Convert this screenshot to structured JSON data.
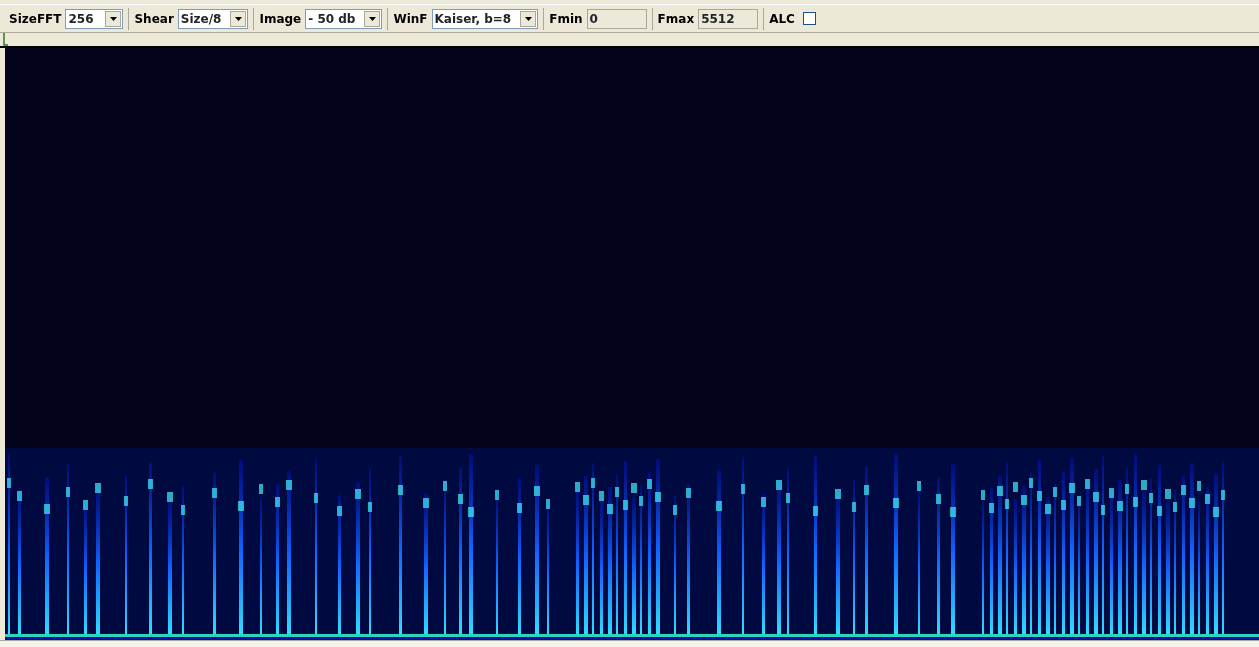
{
  "toolbar": [
    {
      "kind": "dropdown",
      "label": "SizeFFT",
      "value": "256"
    },
    {
      "kind": "dropdown",
      "label": "Shear",
      "value": "Size/8"
    },
    {
      "kind": "dropdown",
      "label": "Image",
      "value": "- 50 db"
    },
    {
      "kind": "dropdown",
      "label": "WinF",
      "value": "Kaiser, b=8"
    },
    {
      "kind": "readonly",
      "label": "Fmin",
      "value": "0"
    },
    {
      "kind": "readonly",
      "label": "Fmax",
      "value": "5512"
    },
    {
      "kind": "checkbox",
      "label": "ALC",
      "checked": false
    }
  ]
}
